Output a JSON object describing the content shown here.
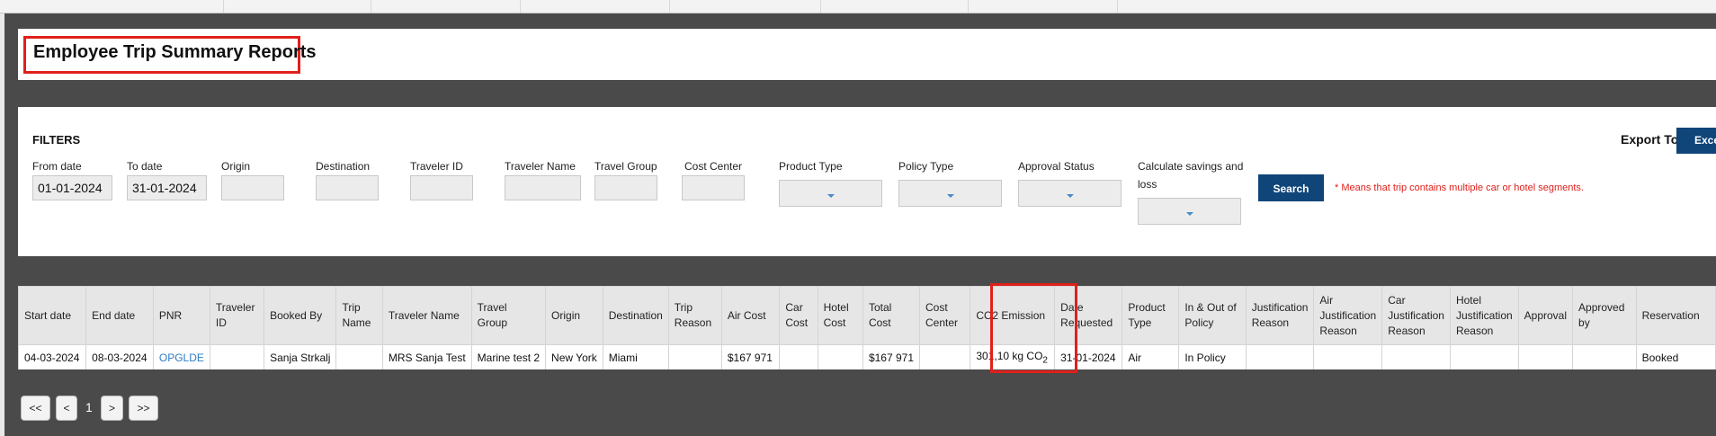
{
  "page": {
    "title": "Employee Trip Summary Reports"
  },
  "filters": {
    "heading": "FILTERS",
    "from_date_label": "From date",
    "from_date_value": "01-01-2024",
    "to_date_label": "To date",
    "to_date_value": "31-01-2024",
    "origin_label": "Origin",
    "destination_label": "Destination",
    "traveler_id_label": "Traveler ID",
    "traveler_name_label": "Traveler Name",
    "travel_group_label": "Travel Group",
    "cost_center_label": "Cost Center",
    "product_type_label": "Product Type",
    "policy_type_label": "Policy Type",
    "approval_status_label": "Approval Status",
    "savings_label_line1": "Calculate savings and",
    "savings_label_line2": "loss",
    "search_label": "Search",
    "note": "* Means that trip contains multiple car or hotel segments."
  },
  "export": {
    "label": "Export To",
    "excel_label": "Excel"
  },
  "table": {
    "columns": [
      "Start date",
      "End date",
      "PNR",
      "Traveler ID",
      "Booked By",
      "Trip Name",
      "Traveler Name",
      "Travel Group",
      "Origin",
      "Destination",
      "Trip Reason",
      "Air Cost",
      "Car Cost",
      "Hotel Cost",
      "Total Cost",
      "Cost Center",
      "CO2 Emission",
      "Date Requested",
      "Product Type",
      "In & Out of Policy",
      "Justification Reason",
      "Air Justification Reason",
      "Car Justification Reason",
      "Hotel Justification Reason",
      "Approval",
      "Approved by",
      "Reservation"
    ],
    "rows": [
      {
        "start_date": "04-03-2024",
        "end_date": "08-03-2024",
        "pnr": "OPGLDE",
        "traveler_id": "",
        "booked_by": "Sanja Strkalj",
        "trip_name": "",
        "traveler_name": "MRS Sanja Test",
        "travel_group": "Marine test 2",
        "origin": "New York",
        "destination": "Miami",
        "trip_reason": "",
        "air_cost": "$167 971",
        "car_cost": "",
        "hotel_cost": "",
        "total_cost": "$167 971",
        "cost_center": "",
        "co2_value": "301,10 kg CO",
        "co2_subscript": "2",
        "date_requested": "31-01-2024",
        "product_type": "Air",
        "policy": "In Policy",
        "justification": "",
        "air_justification": "",
        "car_justification": "",
        "hotel_justification": "",
        "approval": "",
        "approved_by": "",
        "reservation": "Booked"
      }
    ]
  },
  "pagination": {
    "first": "<<",
    "prev": "<",
    "current": "1",
    "next": ">",
    "last": ">>"
  },
  "colors": {
    "accent": "#10457a",
    "highlight": "#e0201b",
    "link": "#2f7dc8",
    "backdrop": "#4a4a4a"
  }
}
